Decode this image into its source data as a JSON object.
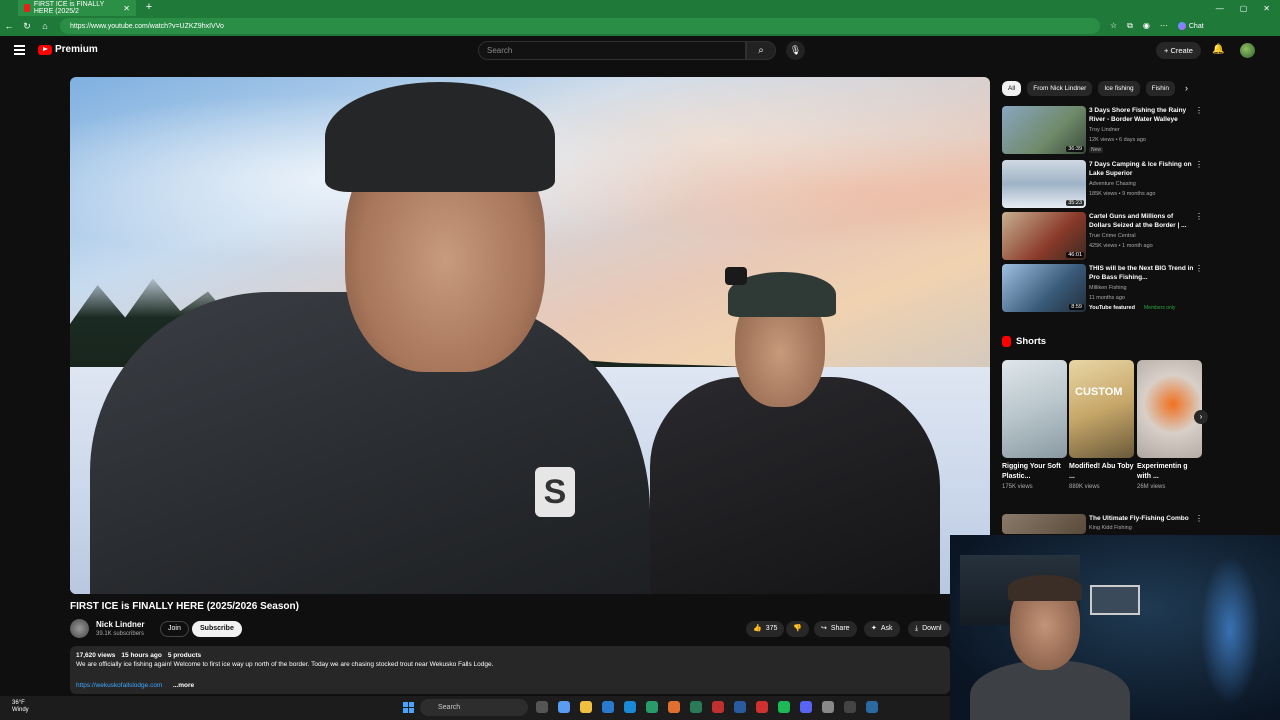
{
  "browser": {
    "tab_title": "FIRST ICE is FINALLY HERE (2025/2",
    "new_tab": "+",
    "url": "https://www.youtube.com/watch?v=UZKZ9hxIVVo",
    "chat_label": "Chat"
  },
  "yt": {
    "logo_text": "Premium",
    "search_placeholder": "Search",
    "create_label": "+ Create"
  },
  "video": {
    "title": "FIRST ICE is FINALLY HERE (2025/2026 Season)",
    "channel": "Nick Lindner",
    "subscribers": "39.1K subscribers",
    "join_label": "Join",
    "subscribe_label": "Subscribe",
    "likes": "375",
    "share_label": "Share",
    "ask_label": "Ask",
    "download_label": "Downl",
    "views": "17,620 views",
    "age": "15 hours ago",
    "products": "5 products",
    "description": "We are officially ice fishing again! Welcome to first ice way up north of the border. Today we are chasing stocked trout near Wekusko Falls Lodge.",
    "link": "https://wekuskofallslodge.com",
    "more": "...more"
  },
  "chips": [
    "All",
    "From Nick Lindner",
    "Ice fishing",
    "Fishin"
  ],
  "recommendations": [
    {
      "title": "3 Days Shore Fishing the Rainy River - Border Water Walleye",
      "channel": "Troy Lindner",
      "meta": "12K views • 6 days ago",
      "badge": "New",
      "duration": "36:39",
      "thumb_color": "#6f8a6a"
    },
    {
      "title": "7 Days Camping & Ice Fishing on Lake Superior",
      "channel": "Adventure Chasing",
      "meta": "185K views • 9 months ago",
      "badge": "",
      "duration": "35:23",
      "thumb_color": "#9fb3c6"
    },
    {
      "title": "Cartel Guns and Millions of Dollars Seized at the Border | ...",
      "channel": "True Crime Central",
      "meta": "425K views • 1 month ago",
      "badge": "",
      "duration": "46:01",
      "thumb_color": "#8a3a2a"
    },
    {
      "title": "THIS will be the Next BIG Trend in Pro Bass Fishing...",
      "channel": "Milliken Fishing",
      "meta": "11 months ago",
      "badge": "YouTube featured",
      "duration": "8:59",
      "thumb_color": "#3a5a7a"
    },
    {
      "title": "The Ultimate Fly-Fishing Combo",
      "channel": "King Kidd Fishing",
      "meta": "",
      "badge": "",
      "duration": "",
      "thumb_color": "#5a4a3a"
    }
  ],
  "members_only": "Members only",
  "shorts": {
    "heading": "Shorts",
    "items": [
      {
        "title": "Rigging Your Soft Plastic...",
        "views": "175K views",
        "thumb_color": "#b9c6cc"
      },
      {
        "title": "Modified! Abu Toby ...",
        "views": "889K views",
        "thumb_color": "#c8a86a",
        "overlay": "CUSTOM"
      },
      {
        "title": "Experimentin g with ...",
        "views": "26M views",
        "thumb_color": "#d8d0c8"
      }
    ]
  },
  "taskbar": {
    "temp": "36°F",
    "condition": "Windy",
    "search_label": "Search"
  }
}
